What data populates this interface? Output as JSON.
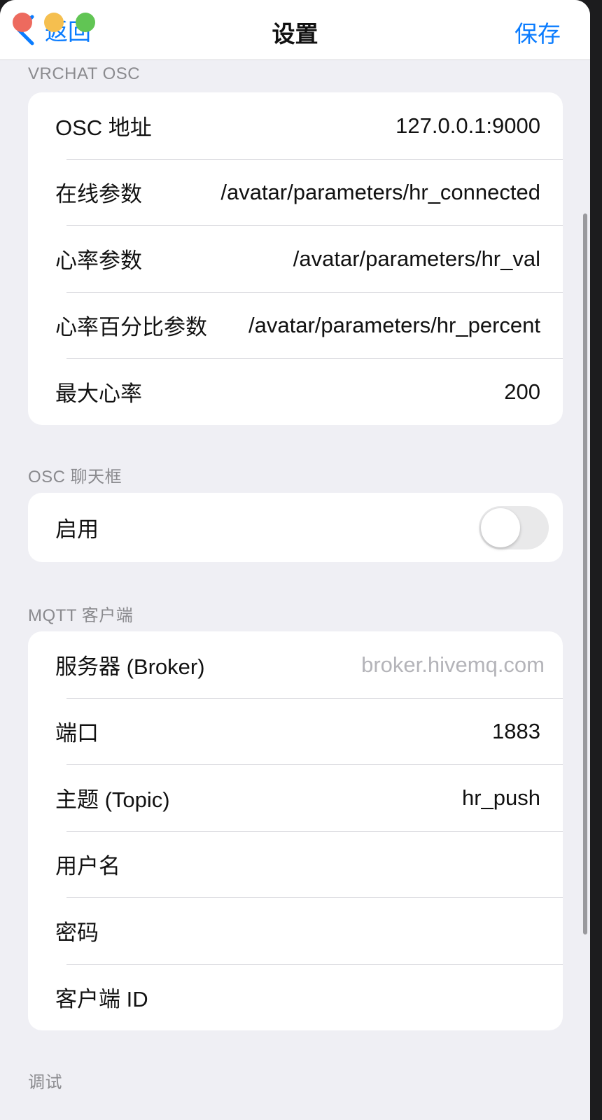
{
  "window": {
    "title": "设置",
    "back_label": "返回",
    "save_label": "保存"
  },
  "sections": {
    "vrchat_osc": {
      "header": "VRCHAT OSC",
      "rows": [
        {
          "label": "OSC 地址",
          "value": "127.0.0.1:9000"
        },
        {
          "label": "在线参数",
          "value": "/avatar/parameters/hr_connected"
        },
        {
          "label": "心率参数",
          "value": "/avatar/parameters/hr_val"
        },
        {
          "label": "心率百分比参数",
          "value": "/avatar/parameters/hr_percent"
        },
        {
          "label": "最大心率",
          "value": "200"
        }
      ]
    },
    "osc_chatbox": {
      "header": "OSC 聊天框",
      "enable_label": "启用",
      "enabled": false
    },
    "mqtt": {
      "header": "MQTT 客户端",
      "broker_label": "服务器 (Broker)",
      "broker_placeholder": "broker.hivemq.com",
      "rows": [
        {
          "label": "端口",
          "value": "1883"
        },
        {
          "label": "主题 (Topic)",
          "value": "hr_push"
        },
        {
          "label": "用户名",
          "value": ""
        },
        {
          "label": "密码",
          "value": ""
        },
        {
          "label": "客户端 ID",
          "value": ""
        }
      ]
    },
    "debug": {
      "header": "调试"
    }
  },
  "colors": {
    "accent": "#0a7cff",
    "background": "#efeff4",
    "card": "#ffffff",
    "placeholder": "#b4b4b9",
    "section_header": "#8a8a8e"
  }
}
